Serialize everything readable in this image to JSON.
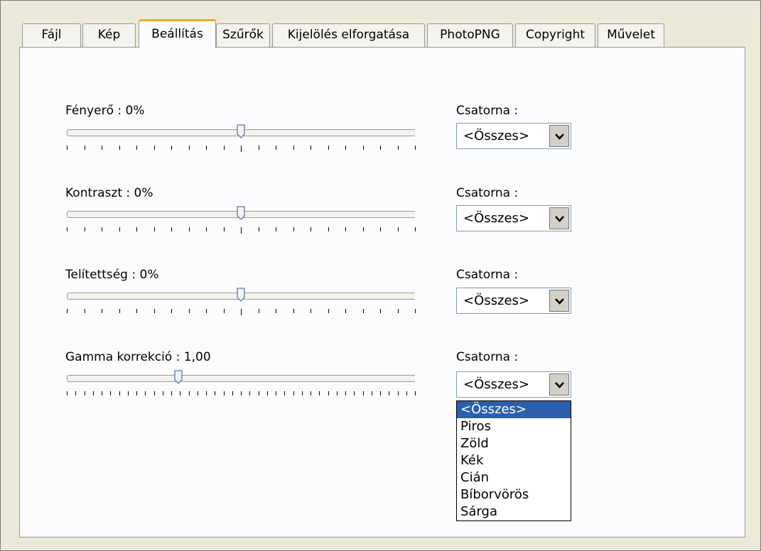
{
  "tabs": [
    {
      "label": "Fájl",
      "active": false
    },
    {
      "label": "Kép",
      "active": false
    },
    {
      "label": "Beállítás",
      "active": true
    },
    {
      "label": "Szűrők",
      "active": false
    },
    {
      "label": "Kijelölés elforgatása",
      "active": false
    },
    {
      "label": "PhotoPNG",
      "active": false
    },
    {
      "label": "Copyright",
      "active": false
    },
    {
      "label": "Művelet",
      "active": false
    }
  ],
  "adjustments": [
    {
      "label": "Fényerő : 0%",
      "slider_value": 0.5,
      "channel_label": "Csatorna :",
      "channel_value": "<Összes>"
    },
    {
      "label": "Kontraszt : 0%",
      "slider_value": 0.5,
      "channel_label": "Csatorna :",
      "channel_value": "<Összes>"
    },
    {
      "label": "Telítettség : 0%",
      "slider_value": 0.5,
      "channel_label": "Csatorna :",
      "channel_value": "<Összes>"
    },
    {
      "label": "Gamma korrekció : 1,00",
      "slider_value": 0.32,
      "channel_label": "Csatorna :",
      "channel_value": "<Összes>"
    }
  ],
  "channel_options": [
    "<Összes>",
    "Piros",
    "Zöld",
    "Kék",
    "Cián",
    "Bíborvörös",
    "Sárga"
  ],
  "selected_option": "<Összes>",
  "colors": {
    "selection": "#2b5fae",
    "active_tab_accent": "#f1a830",
    "window_bg": "#ece9d8"
  },
  "icons": {
    "dropdown_arrow": "chevron-down-icon",
    "slider_thumb": "slider-thumb-icon"
  }
}
